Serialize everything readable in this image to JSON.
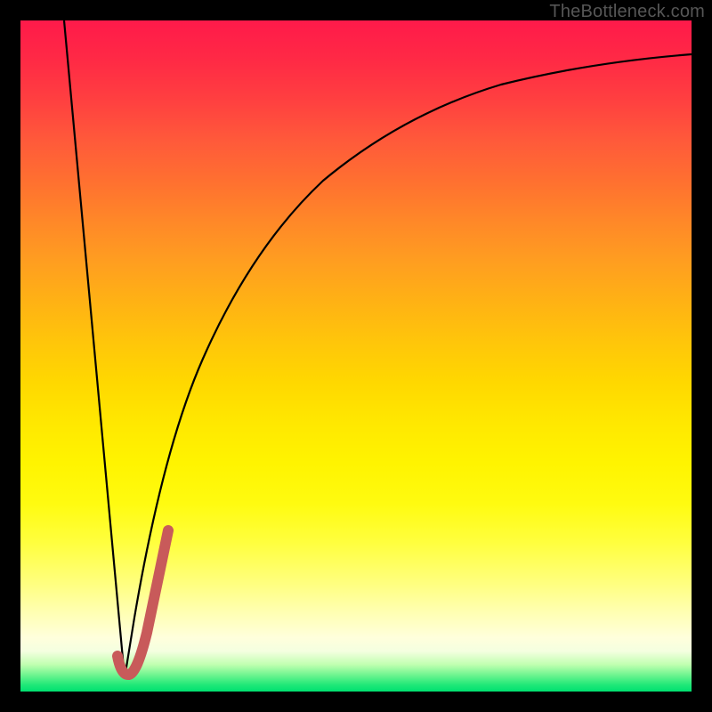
{
  "watermark": "TheBottleneck.com",
  "colors": {
    "frame": "#000000",
    "curve": "#000000",
    "accent": "#c85a5a",
    "gradient_top": "#ff1a4a",
    "gradient_bottom": "#00e070"
  },
  "chart_data": {
    "type": "line",
    "title": "",
    "xlabel": "",
    "ylabel": "",
    "xlim": [
      0,
      100
    ],
    "ylim": [
      0,
      100
    ],
    "grid": false,
    "note": "Axes are unlabeled in the source image; values are estimated percentages of plot width/height (0,0 = bottom-left).",
    "series": [
      {
        "name": "left-descent",
        "type": "line",
        "color": "#000000",
        "x": [
          6.5,
          15.5
        ],
        "values": [
          100,
          2
        ]
      },
      {
        "name": "right-ascent",
        "type": "line",
        "color": "#000000",
        "x": [
          15.5,
          17,
          19,
          21,
          23.5,
          26,
          30,
          35,
          40,
          46,
          53,
          61,
          70,
          80,
          90,
          100
        ],
        "values": [
          2,
          11,
          21,
          30,
          39,
          47,
          56,
          65,
          71,
          77,
          82,
          86,
          89.5,
          92,
          93.8,
          95
        ]
      },
      {
        "name": "accent-j",
        "type": "line",
        "color": "#c85a5a",
        "stroke_width": 12,
        "x": [
          14.5,
          15.8,
          17.5,
          19.5,
          22
        ],
        "values": [
          5.3,
          2.4,
          4.5,
          13,
          24
        ]
      }
    ]
  }
}
